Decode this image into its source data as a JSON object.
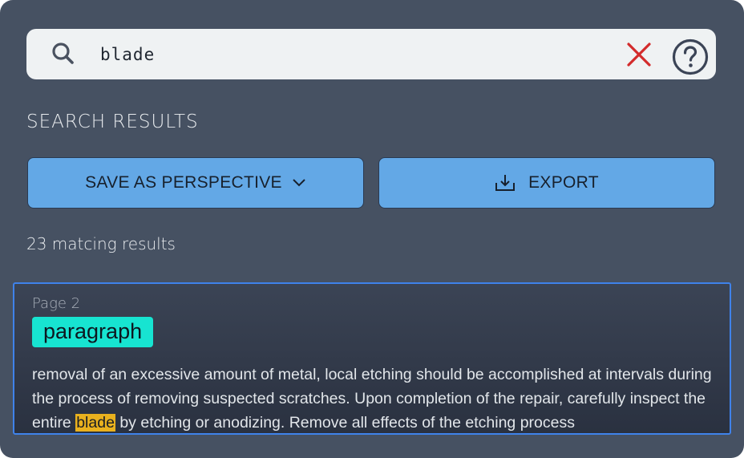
{
  "search": {
    "value": "blade",
    "clear_icon": "close-x-icon",
    "help_icon": "help-circle-icon",
    "search_icon": "magnifier-icon"
  },
  "section_title": "SEARCH RESULTS",
  "actions": {
    "save_label": "SAVE AS PERSPECTIVE",
    "export_label": "EXPORT"
  },
  "result_count": "23 matcing results",
  "result": {
    "page": "Page 2",
    "tag": "paragraph",
    "text_before": "removal of an excessive amount of metal, local etching should be accomplished at intervals during the process of removing suspected scratches. Upon completion of the repair, carefully inspect the entire ",
    "highlight": "blade",
    "text_after": " by etching or anodizing. Remove all effects of the etching process"
  },
  "colors": {
    "panel": "#465162",
    "button": "#63a8e6",
    "tag": "#17e4d1",
    "highlight": "#e9b11e",
    "selection_border": "#3f82ea",
    "clear_icon": "#d32b2b"
  }
}
